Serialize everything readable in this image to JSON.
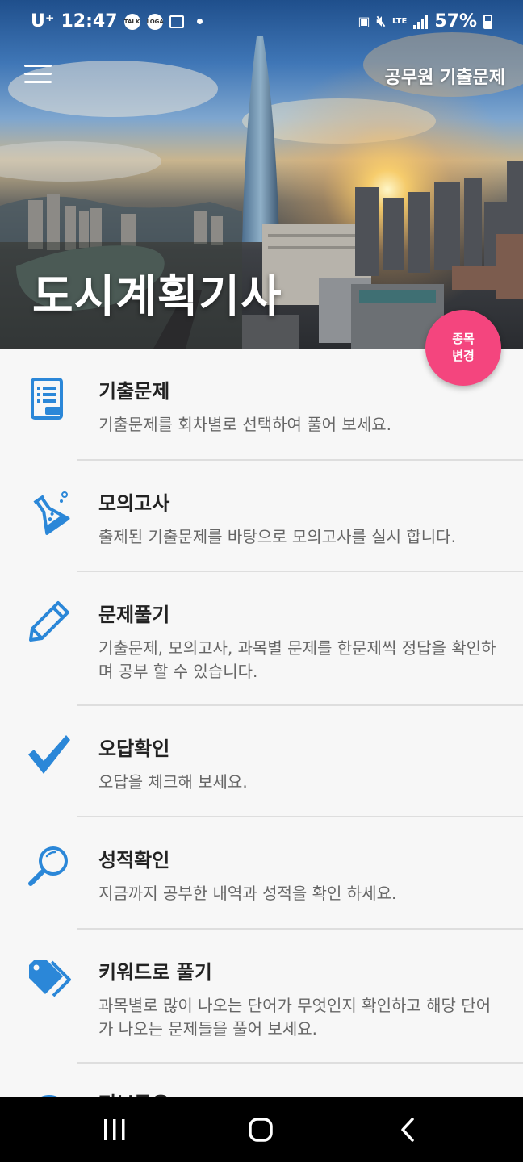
{
  "status_bar": {
    "carrier": "U⁺",
    "time": "12:47",
    "badge_talk": "TALK",
    "badge_loga": "LOGA",
    "network": "LTE",
    "battery": "57%"
  },
  "header": {
    "app_title": "공무원 기출문제",
    "hero_title": "도시계획기사"
  },
  "fab": {
    "line1": "종목",
    "line2": "변경"
  },
  "menu": [
    {
      "title": "기출문제",
      "desc": "기출문제를 회차별로 선택하여 풀어 보세요.",
      "icon": "document-icon"
    },
    {
      "title": "모의고사",
      "desc": "출제된 기출문제를 바탕으로 모의고사를 실시 합니다.",
      "icon": "flask-icon"
    },
    {
      "title": "문제풀기",
      "desc": "기출문제, 모의고사, 과목별 문제를 한문제씩 정답을 확인하며 공부 할 수 있습니다.",
      "icon": "pencil-icon"
    },
    {
      "title": "오답확인",
      "desc": "오답을 체크해 보세요.",
      "icon": "checkmark-icon"
    },
    {
      "title": "성적확인",
      "desc": "지금까지 공부한 내역과 성적을 확인 하세요.",
      "icon": "magnifier-icon"
    },
    {
      "title": "키워드로 풀기",
      "desc": "과목별로 많이 나오는 단어가 무엇인지 확인하고 해당 단어가 나오는 문제들을 풀어 보세요.",
      "icon": "tag-icon"
    },
    {
      "title": "정보공유",
      "desc": "",
      "icon": "info-icon"
    }
  ],
  "colors": {
    "accent": "#2b87d8",
    "fab": "#f4457e"
  }
}
